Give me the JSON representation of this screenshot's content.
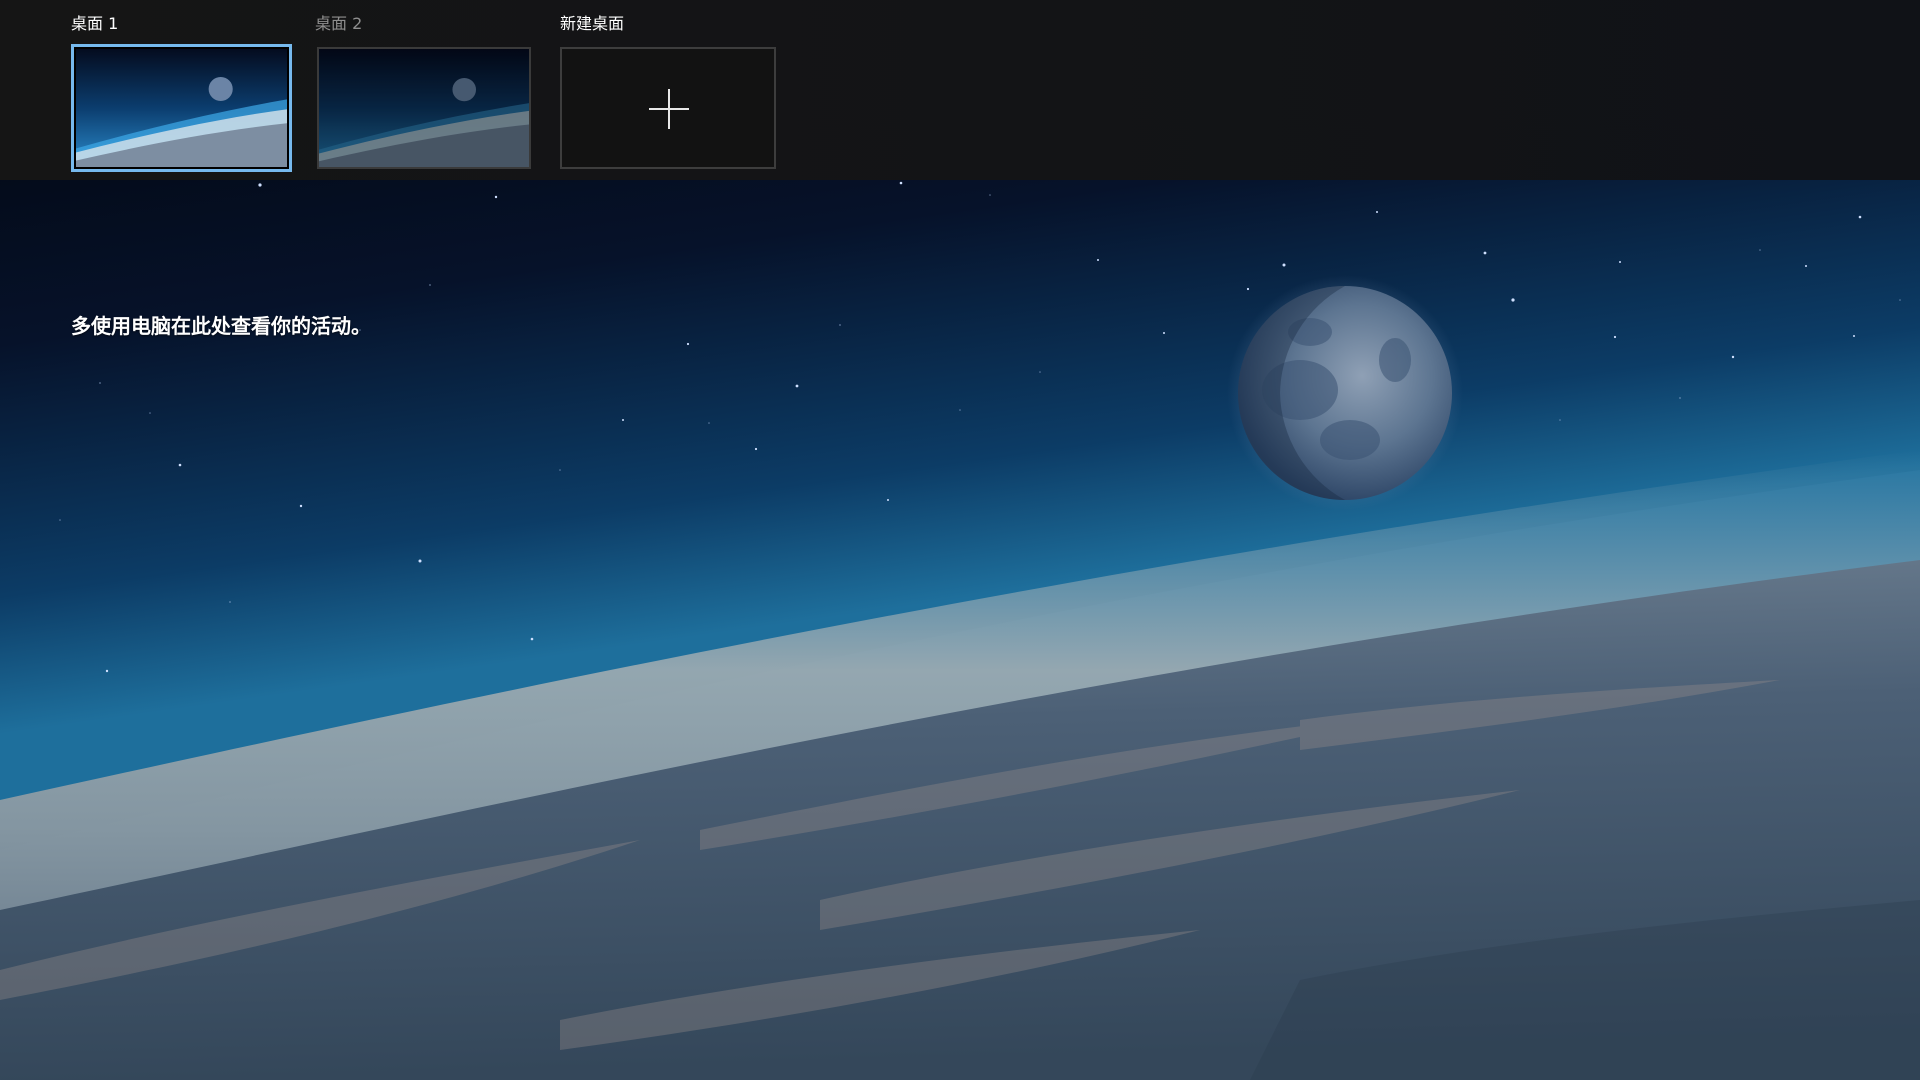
{
  "task_view": {
    "desktops": [
      {
        "label": "桌面 1",
        "selected": true
      },
      {
        "label": "桌面 2",
        "selected": false
      }
    ],
    "new_desktop": {
      "label": "新建桌面",
      "icon": "plus-icon"
    }
  },
  "timeline": {
    "empty_message": "多使用电脑在此处查看你的活动。"
  },
  "wallpaper": {
    "subject": "earth-horizon-with-moon",
    "colors": {
      "space": "#02060f",
      "atmosphere": "#1e6f9c",
      "haze": "#9aa3a8",
      "ground": "#3c4f63",
      "moon": "#4d6787"
    }
  },
  "colors": {
    "bar_background": "#141414",
    "selected_border": "#76b9ed",
    "tile_border": "#3d3d3d",
    "text_primary": "#ffffff",
    "text_dim": "#8f8f8f"
  }
}
